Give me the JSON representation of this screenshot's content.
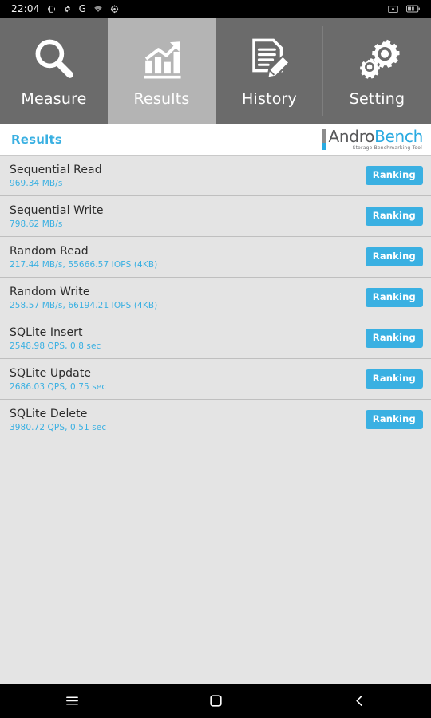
{
  "statusbar": {
    "time": "22:04",
    "left_icons": [
      "vibrate-icon",
      "gear-icon",
      "google-icon",
      "wifi-icon",
      "settings-icon"
    ],
    "google_glyph": "G",
    "right_icons": [
      "screenshot-icon",
      "battery-icon"
    ]
  },
  "tabs": [
    {
      "label": "Measure",
      "icon": "magnifier-icon",
      "active": false
    },
    {
      "label": "Results",
      "icon": "bar-chart-arrow-icon",
      "active": true
    },
    {
      "label": "History",
      "icon": "document-pencil-icon",
      "active": false
    },
    {
      "label": "Setting",
      "icon": "gears-icon",
      "active": false
    }
  ],
  "header": {
    "title": "Results",
    "brand_first": "Andro",
    "brand_second": "Bench",
    "brand_tagline": "Storage Benchmarking Tool"
  },
  "results": {
    "button_label": "Ranking",
    "rows": [
      {
        "title": "Sequential Read",
        "value": "969.34 MB/s"
      },
      {
        "title": "Sequential Write",
        "value": "798.62 MB/s"
      },
      {
        "title": "Random Read",
        "value": "217.44 MB/s, 55666.57 IOPS (4KB)"
      },
      {
        "title": "Random Write",
        "value": "258.57 MB/s, 66194.21 IOPS (4KB)"
      },
      {
        "title": "SQLite Insert",
        "value": "2548.98 QPS, 0.8 sec"
      },
      {
        "title": "SQLite Update",
        "value": "2686.03 QPS, 0.75 sec"
      },
      {
        "title": "SQLite Delete",
        "value": "3980.72 QPS, 0.51 sec"
      }
    ]
  },
  "navbar": {
    "items": [
      "recents-icon",
      "home-icon",
      "back-icon"
    ]
  },
  "colors": {
    "accent_blue": "#3ab0e2",
    "brand_blue": "#29aae1",
    "tab_inactive": "#6b6b6b",
    "tab_active": "#b4b4b4",
    "list_bg": "#e4e4e4",
    "row_border": "#bfbfbf",
    "title_text": "#2b2b2b",
    "system_black": "#000000"
  }
}
